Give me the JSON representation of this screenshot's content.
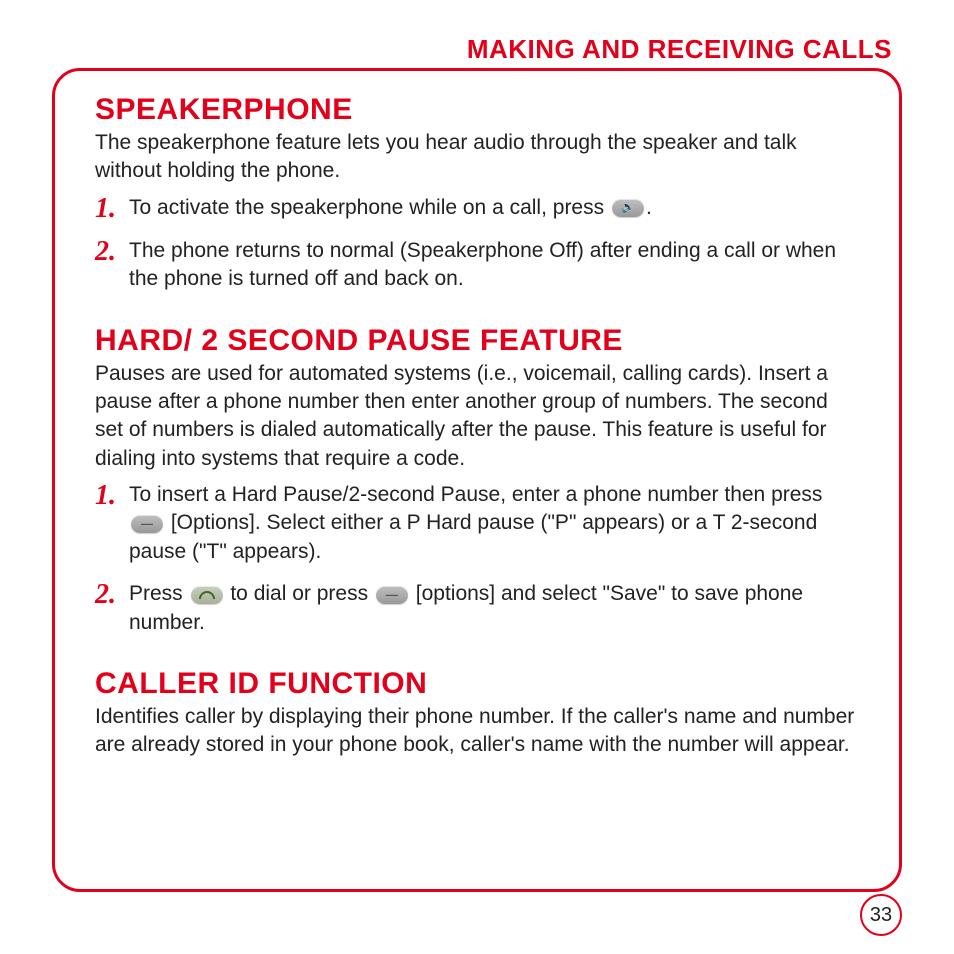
{
  "header": "MAKING AND RECEIVING CALLS",
  "page_number": "33",
  "sections": {
    "speakerphone": {
      "title": "SPEAKERPHONE",
      "intro": "The speakerphone feature lets you hear audio through the speaker and talk without holding the phone.",
      "items": {
        "1": {
          "num": "1.",
          "pre": "To activate the speakerphone while on a call, press ",
          "post": "."
        },
        "2": {
          "num": "2.",
          "text": "The phone returns to normal (Speakerphone Off) after ending a call or when the phone is turned off and back on."
        }
      }
    },
    "pause": {
      "title": "HARD/ 2 SECOND PAUSE FEATURE",
      "intro": "Pauses are used for automated systems (i.e., voicemail, calling cards).  Insert a pause after a phone number then enter another group of numbers.  The second set of numbers is dialed automatically after the pause.  This feature is useful for dialing into systems that require a code.",
      "items": {
        "1": {
          "num": "1.",
          "pre": "To insert a Hard Pause/2-second Pause, enter a phone number then press ",
          "post": " [Options]. Select either a P Hard pause (\"P\" appears) or a T 2-second pause (\"T\" appears)."
        },
        "2": {
          "num": "2.",
          "a": "Press ",
          "b": " to dial or press ",
          "c": " [options] and select \"Save\" to save phone number."
        }
      }
    },
    "callerid": {
      "title": "CALLER ID FUNCTION",
      "intro": "Identifies caller by displaying their phone number.  If the caller's name and number are already stored in your phone book, caller's name with the number will appear."
    }
  }
}
